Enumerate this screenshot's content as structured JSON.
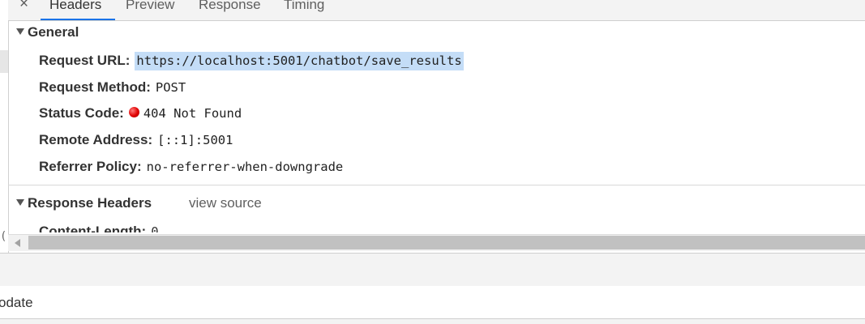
{
  "tabs": {
    "close": "×",
    "items": [
      {
        "label": "Headers",
        "active": true
      },
      {
        "label": "Preview",
        "active": false
      },
      {
        "label": "Response",
        "active": false
      },
      {
        "label": "Timing",
        "active": false
      }
    ]
  },
  "general": {
    "title": "General",
    "rows": [
      {
        "key": "Request URL:",
        "value": "https://localhost:5001/chatbot/save_results"
      },
      {
        "key": "Request Method:",
        "value": "POST"
      },
      {
        "key": "Status Code:",
        "value": "404 Not Found"
      },
      {
        "key": "Remote Address:",
        "value": "[::1]:5001"
      },
      {
        "key": "Referrer Policy:",
        "value": "no-referrer-when-downgrade"
      }
    ]
  },
  "response_headers": {
    "title": "Response Headers",
    "view_source": "view source",
    "partial_row": {
      "key": "Content-Length:",
      "value": "0"
    }
  },
  "gutter_char": "(",
  "bottom_text": "odate",
  "colors": {
    "accent": "#1a73e8",
    "url_selection": "#c4ddf7",
    "status_error": "#e00000"
  }
}
